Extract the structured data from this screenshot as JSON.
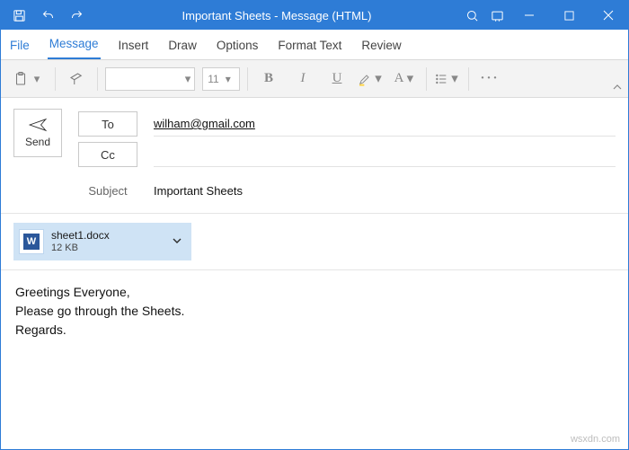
{
  "titlebar": {
    "title": "Important Sheets  -  Message (HTML)"
  },
  "tabs": {
    "file": "File",
    "message": "Message",
    "insert": "Insert",
    "draw": "Draw",
    "options": "Options",
    "format_text": "Format Text",
    "review": "Review"
  },
  "ribbon": {
    "font_size_placeholder": "11"
  },
  "compose": {
    "send_label": "Send",
    "to_label": "To",
    "cc_label": "Cc",
    "subject_label": "Subject",
    "to_value": "wilham@gmail.com",
    "cc_value": "",
    "subject_value": "Important Sheets"
  },
  "attachment": {
    "icon_letter": "W",
    "name": "sheet1.docx",
    "size": "12 KB"
  },
  "body": {
    "line1": "Greetings Everyone,",
    "line2": "Please go through the Sheets.",
    "line3": "Regards."
  },
  "watermark": "wsxdn.com"
}
